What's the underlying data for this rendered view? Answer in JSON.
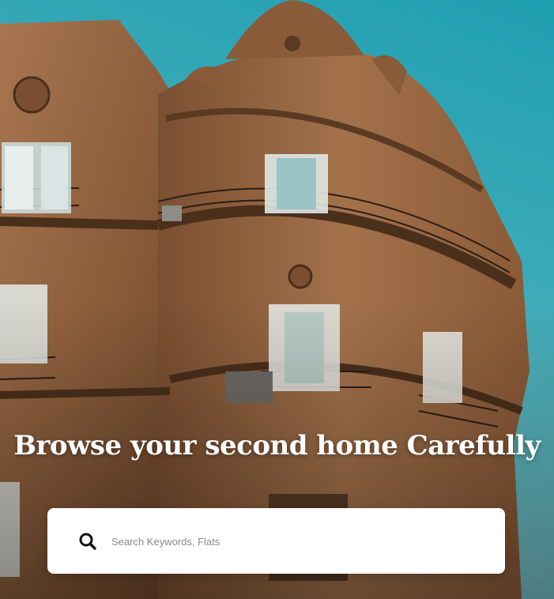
{
  "hero": {
    "title": "Browse your second home Carefully",
    "photo_description_icon": "building-photo"
  },
  "search": {
    "placeholder": "Search Keywords, Flats",
    "value": "",
    "icon": "search-icon"
  },
  "colors": {
    "sky": "#2aa3b3",
    "stone": "#9b6a45",
    "stone_dark": "#5e3d26",
    "title": "#ffffff",
    "search_bg": "#ffffff",
    "placeholder": "#8a8a8a",
    "icon": "#111111"
  }
}
